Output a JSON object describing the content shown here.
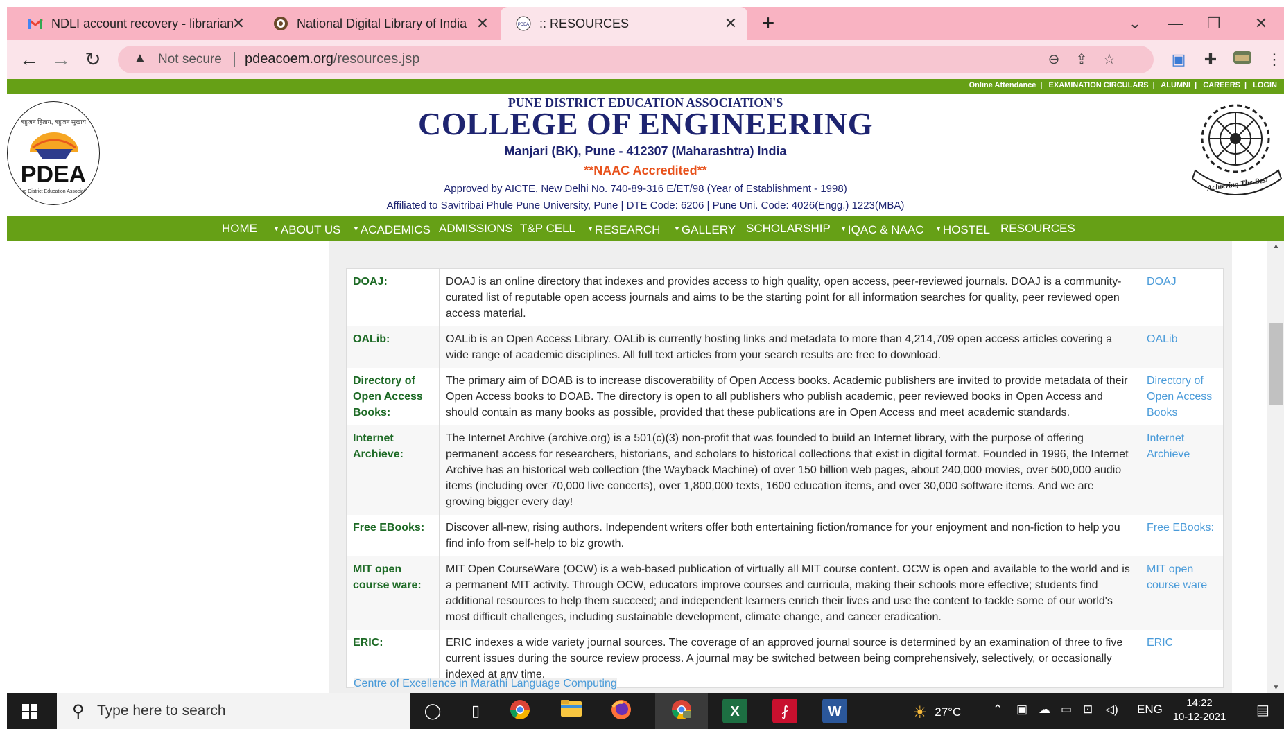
{
  "browser": {
    "tabs": [
      {
        "title": "NDLI account recovery - librarian",
        "icon": "gmail-icon"
      },
      {
        "title": "National Digital Library of India",
        "icon": "ndli-icon"
      },
      {
        "title": ":: RESOURCES",
        "icon": "pdea-favicon",
        "active": true
      }
    ],
    "new_tab": "+",
    "security": "Not secure",
    "url_host": "pdeacoem.org",
    "url_path": "/resources.jsp"
  },
  "site": {
    "top_links": [
      "Online Attendance",
      "EXAMINATION CIRCULARS",
      "ALUMNI",
      "CAREERS",
      "LOGIN"
    ],
    "assoc": "PUNE DISTRICT EDUCATION ASSOCIATION'S",
    "college": "COLLEGE OF ENGINEERING",
    "address": "Manjari (BK), Pune - 412307 (Maharashtra) India",
    "naac": "**NAAC Accredited**",
    "approved": "Approved by AICTE, New Delhi No. 740-89-316 E/ET/98 (Year of Establishment - 1998)",
    "affiliated": "Affiliated to Savitribai Phule Pune University, Pune | DTE Code: 6206 | Pune Uni. Code: 4026(Engg.) 1223(MBA)",
    "logo_left_text": "PDEA",
    "logo_left_motto": "बहुजन हिताय, बहुजन सुखाय",
    "logo_left_sub": "Pune District Education Association",
    "logo_right_motto": "Achieving The Best",
    "menu": [
      {
        "label": "HOME",
        "caret": false
      },
      {
        "label": "ABOUT US",
        "caret": true
      },
      {
        "label": "ACADEMICS",
        "caret": true
      },
      {
        "label": "ADMISSIONS",
        "caret": false
      },
      {
        "label": "T&P CELL",
        "caret": false
      },
      {
        "label": "RESEARCH",
        "caret": true
      },
      {
        "label": "GALLERY",
        "caret": true
      },
      {
        "label": "SCHOLARSHIP",
        "caret": false
      },
      {
        "label": "IQAC & NAAC",
        "caret": true
      },
      {
        "label": "HOSTEL",
        "caret": true
      },
      {
        "label": "RESOURCES",
        "caret": false
      }
    ]
  },
  "resources": [
    {
      "name": "DOAJ:",
      "desc": "DOAJ is an online directory that indexes and provides access to high quality, open access, peer-reviewed journals. DOAJ is a community-curated list of reputable open access journals and aims to be the starting point for all information searches for quality, peer reviewed open access material.",
      "link": "DOAJ"
    },
    {
      "name": "OALib:",
      "desc": "OALib is an Open Access Library. OALib is currently hosting links and metadata to more than 4,214,709 open access articles covering a wide range of academic disciplines. All full text articles from your search results are free to download.",
      "link": "OALib"
    },
    {
      "name": "Directory of Open Access Books:",
      "desc": "The primary aim of DOAB is to increase discoverability of Open Access books. Academic publishers are invited to provide metadata of their Open Access books to DOAB. The directory is open to all publishers who publish academic, peer reviewed books in Open Access and should contain as many books as possible, provided that these publications are in Open Access and meet academic standards.",
      "link": "Directory of Open Access Books"
    },
    {
      "name": "Internet Archieve:",
      "desc": "The Internet Archive (archive.org) is a 501(c)(3) non-profit that was founded to build an Internet library, with the purpose of offering permanent access for researchers, historians, and scholars to historical collections that exist in digital format. Founded in 1996, the Internet Archive has an historical web collection (the Wayback Machine) of over 150 billion web pages, about 240,000 movies, over 500,000 audio items (including over 70,000 live concerts), over 1,800,000 texts, 1600 education items, and over 30,000 software items. And we are growing bigger every day!",
      "link": "Internet Archieve"
    },
    {
      "name": "Free EBooks:",
      "desc": "Discover all-new, rising authors. Independent writers offer both entertaining fiction/romance for your enjoyment and non-fiction to help you find info from self-help to biz growth.",
      "link": "Free EBooks:"
    },
    {
      "name": "MIT open course ware:",
      "desc": "MIT Open CourseWare (OCW) is a web-based publication of virtually all MIT course content. OCW is open and available to the world and is a permanent MIT activity. Through OCW, educators improve courses and curricula, making their schools more effective; students find additional resources to help them succeed; and independent learners enrich their lives and use the content to tackle some of our world's most difficult challenges, including sustainable development, climate change, and cancer eradication.",
      "link": "MIT open course ware"
    },
    {
      "name": "ERIC:",
      "desc": "ERIC indexes a wide variety journal sources. The coverage of an approved journal source is determined by an examination of three to five current issues during the source review process. A journal may be switched between being comprehensively, selectively, or occasionally indexed at any time.",
      "link": "ERIC"
    }
  ],
  "footer_link": "Centre of Excellence in Marathi Language Computing",
  "taskbar": {
    "search_placeholder": "Type here to search",
    "weather": "27°C",
    "lang": "ENG",
    "time": "14:22",
    "date": "10-12-2021"
  },
  "colors": {
    "accent_green": "#66a016",
    "navy": "#1e2470",
    "naac_orange": "#e8521c",
    "tab_pink": "#f9b3c2",
    "link_blue": "#4a9bd9"
  }
}
